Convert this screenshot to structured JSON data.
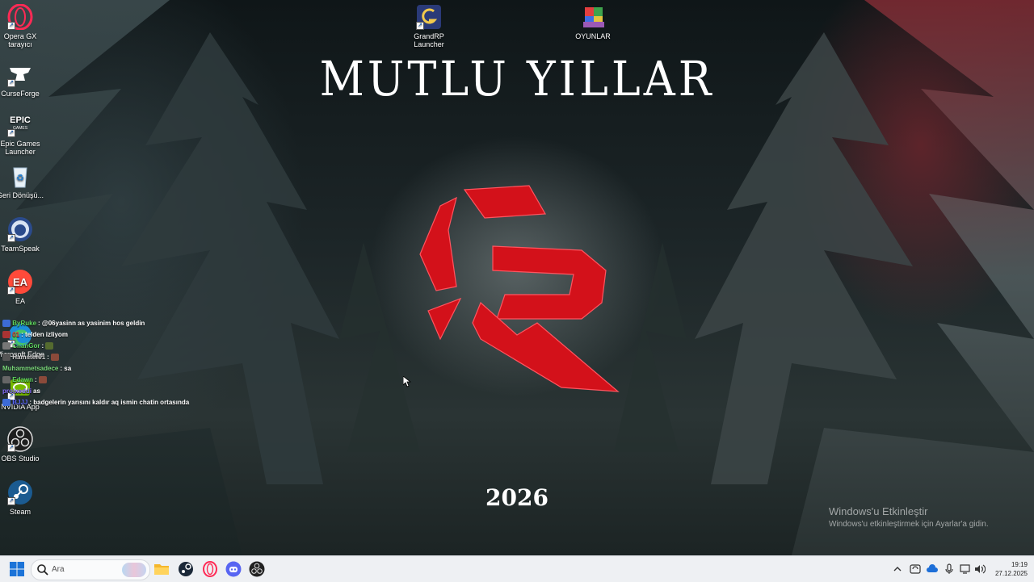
{
  "wallpaper": {
    "title": "MUTLU YILLAR",
    "year": "2026",
    "activation_title": "Windows'u Etkinleştir",
    "activation_subtitle": "Windows'u etkinleştirmek için Ayarlar'a gidin.",
    "logo_color": "#d3111a"
  },
  "desktop_icons_left": [
    {
      "label": "Opera GX tarayıcı",
      "icon": "opera-gx-icon"
    },
    {
      "label": "CurseForge",
      "icon": "curseforge-icon"
    },
    {
      "label": "Epic Games Launcher",
      "icon": "epic-games-icon"
    },
    {
      "label": "Geri Dönüşü...",
      "icon": "recycle-bin-icon"
    },
    {
      "label": "TeamSpeak",
      "icon": "teamspeak-icon"
    },
    {
      "label": "EA",
      "icon": "ea-icon"
    },
    {
      "label": "Microsoft Edge",
      "icon": "edge-icon"
    },
    {
      "label": "NVIDIA App",
      "icon": "nvidia-icon"
    },
    {
      "label": "OBS Studio",
      "icon": "obs-icon"
    },
    {
      "label": "Steam",
      "icon": "steam-icon"
    }
  ],
  "desktop_icons_top": [
    {
      "label": "GrandRP Launcher",
      "icon": "grandrp-icon"
    },
    {
      "label": "OYUNLAR",
      "icon": "folder-games-icon"
    }
  ],
  "chat": [
    {
      "user": "ByRuke",
      "user_color": "#5fd75f",
      "message": ": @06yasinn as yasinim hos geldin"
    },
    {
      "user": "01",
      "user_color": "#e04a4a",
      "message": ": telden izliyom"
    },
    {
      "user": "ChanGor",
      "user_color": "#5fd75f",
      "message": ":"
    },
    {
      "user": "Hamster01",
      "user_color": "#cfcfcf",
      "message": ":"
    },
    {
      "user": "Muhammetsadece",
      "user_color": "#7ad97a",
      "message": ": sa"
    },
    {
      "user": "Edawn",
      "user_color": "#5fd75f",
      "message": ":"
    },
    {
      "user": "proixeddi",
      "user_color": "#8a70ff",
      "message": "as"
    },
    {
      "user": "BJJJ",
      "user_color": "#5f6bff",
      "message": ": badgelerin yarısını kaldır aq ismin chatin ortasında"
    }
  ],
  "taskbar": {
    "search_placeholder": "Ara",
    "pinned": [
      "start-icon",
      "file-explorer-icon",
      "steam-icon",
      "opera-gx-icon",
      "discord-icon",
      "obs-icon"
    ],
    "time": "19:19",
    "date": "27.12.2025"
  }
}
